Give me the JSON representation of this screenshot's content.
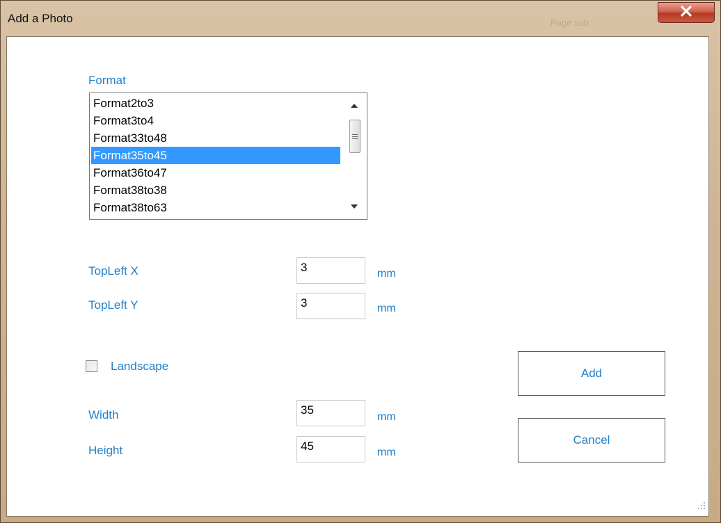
{
  "window": {
    "title": "Add a Photo",
    "background_hint": "Page sub"
  },
  "format": {
    "label": "Format",
    "items": [
      "Format2to3",
      "Format3to4",
      "Format33to48",
      "Format35to45",
      "Format36to47",
      "Format38to38",
      "Format38to63"
    ],
    "selected_index": 3
  },
  "topleft_x": {
    "label": "TopLeft X",
    "value": "3",
    "unit": "mm"
  },
  "topleft_y": {
    "label": "TopLeft Y",
    "value": "3",
    "unit": "mm"
  },
  "landscape": {
    "label": "Landscape",
    "checked": false
  },
  "width": {
    "label": "Width",
    "value": "35",
    "unit": "mm"
  },
  "height": {
    "label": "Height",
    "value": "45",
    "unit": "mm"
  },
  "buttons": {
    "add": "Add",
    "cancel": "Cancel"
  },
  "colors": {
    "label": "#1f7fc8",
    "selection": "#3399ff",
    "close": "#c9503a"
  }
}
